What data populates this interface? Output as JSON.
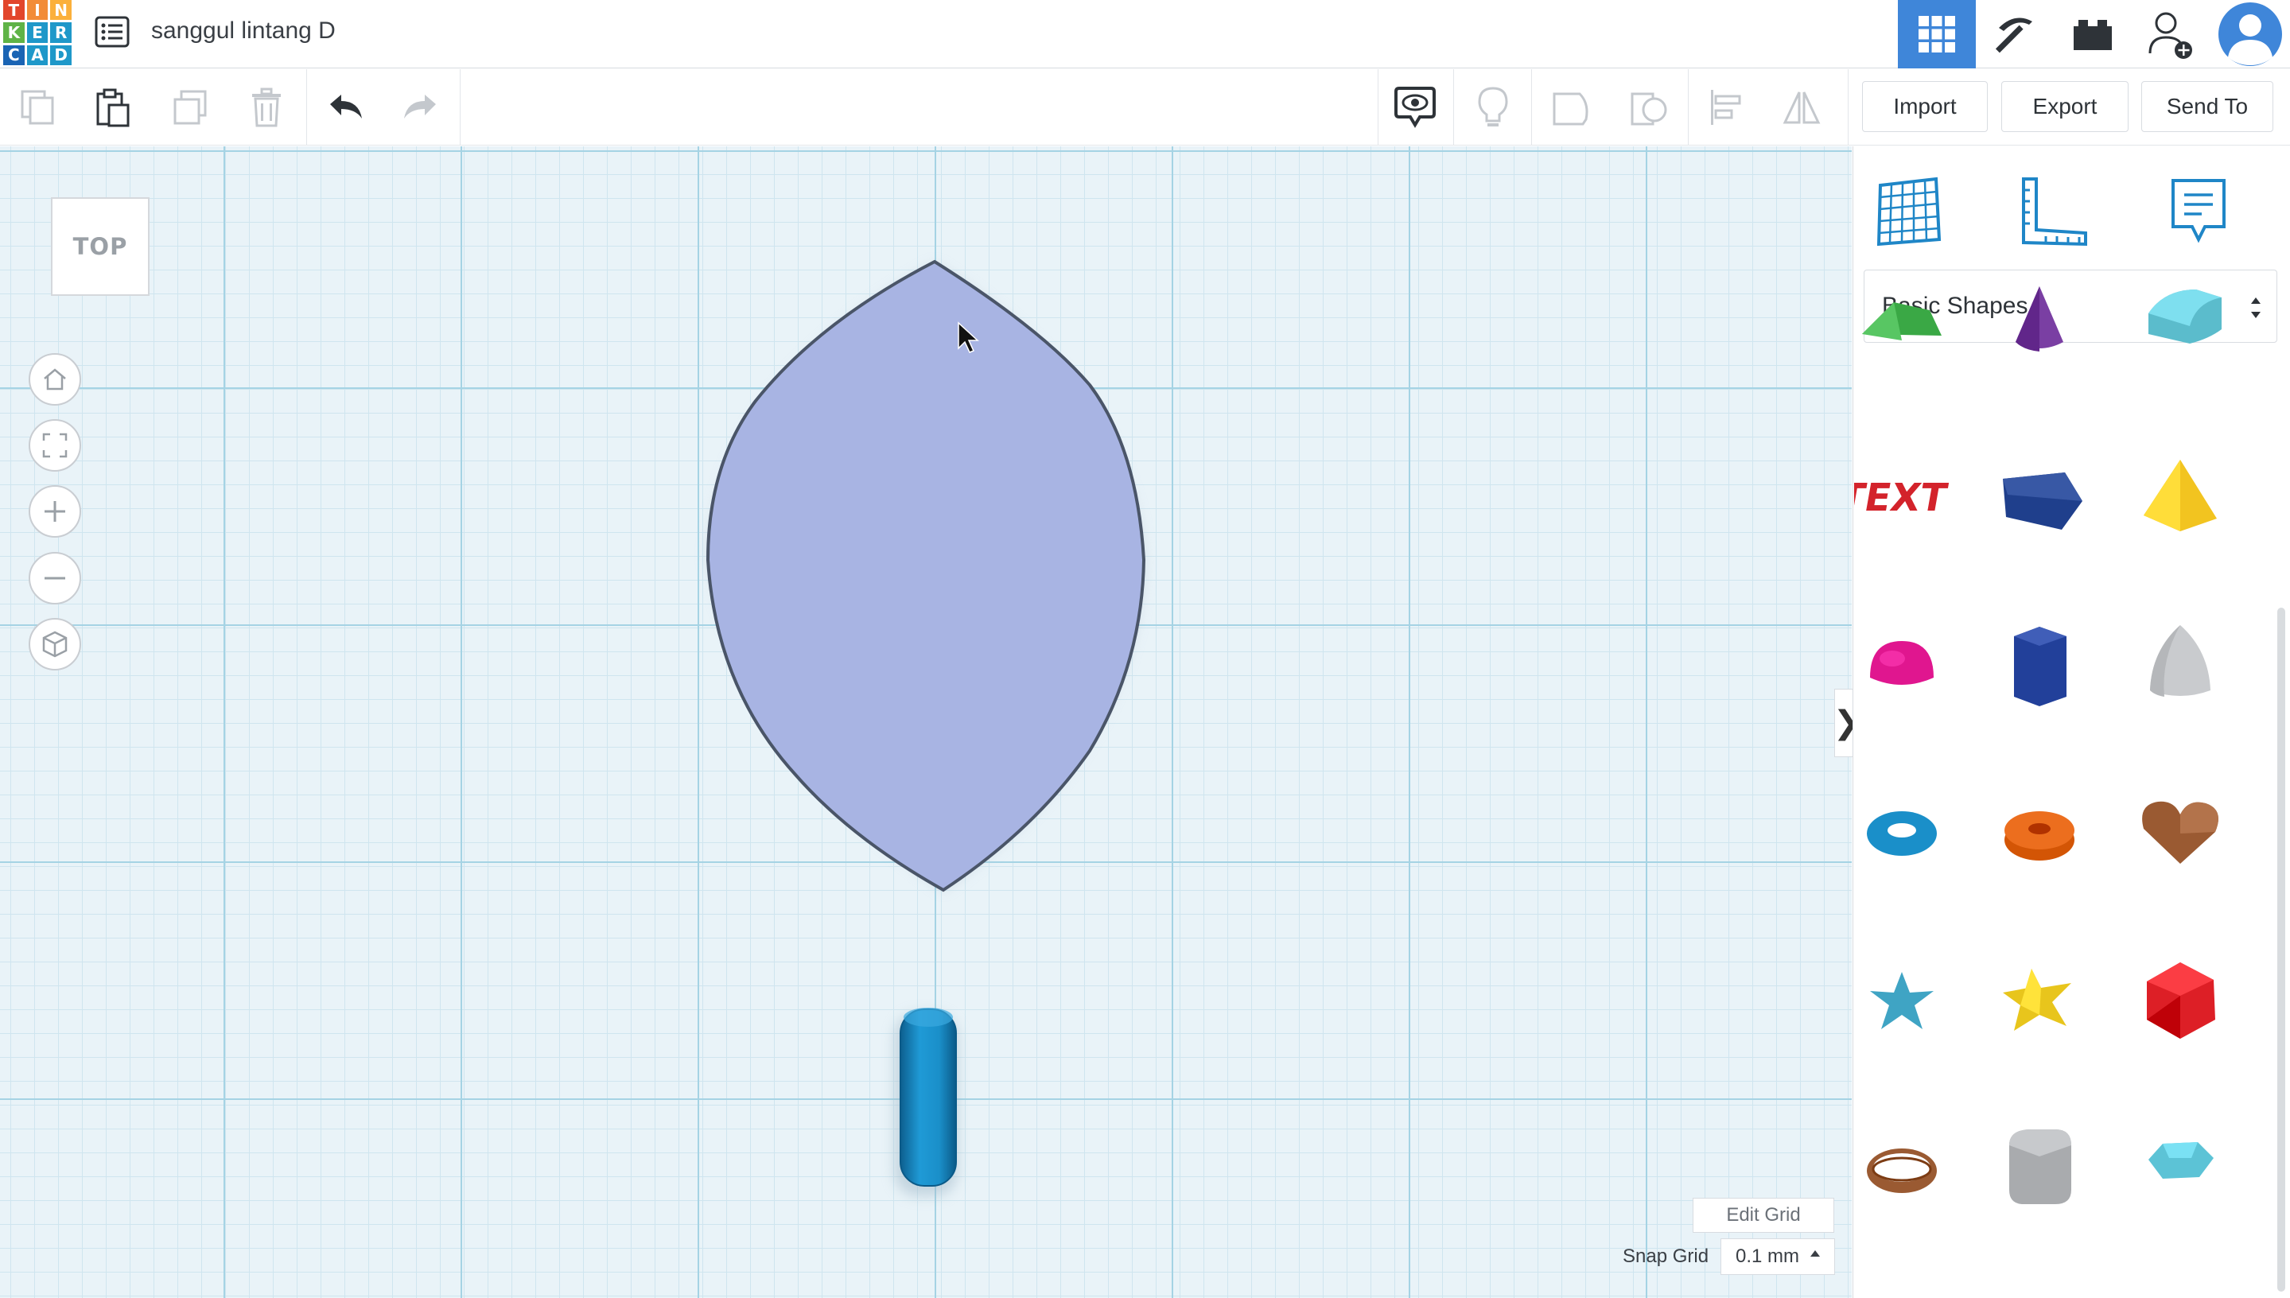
{
  "header": {
    "logo_letters": [
      "T",
      "I",
      "N",
      "K",
      "E",
      "R",
      "C",
      "A",
      "D"
    ],
    "logo_colors": [
      "#e2462c",
      "#f28c38",
      "#fbb03b",
      "#5fb346",
      "#1f98c9",
      "#1f98c9",
      "#1a64b4",
      "#1f98c9",
      "#1f98c9"
    ],
    "document_title": "sanggul lintang D"
  },
  "toolbar": {
    "import_label": "Import",
    "export_label": "Export",
    "send_to_label": "Send To"
  },
  "viewport": {
    "view_cube_label": "TOP"
  },
  "grid": {
    "edit_grid_label": "Edit Grid",
    "snap_grid_label": "Snap Grid",
    "snap_grid_value": "0.1 mm"
  },
  "panel": {
    "library_name": "Basic Shapes",
    "collapse_glyph": "❯",
    "shapes": [
      {
        "name": "Roof",
        "color": "#3aa845"
      },
      {
        "name": "Cone",
        "color": "#7a3fa3"
      },
      {
        "name": "Round Roof",
        "color": "#5bbccc"
      },
      {
        "name": "Text",
        "color": "#d3232b"
      },
      {
        "name": "Polygon",
        "color": "#1f3f8c"
      },
      {
        "name": "Pyramid",
        "color": "#f2c420"
      },
      {
        "name": "Half Sphere",
        "color": "#e0168f"
      },
      {
        "name": "Hexagonal Prism",
        "color": "#22409a"
      },
      {
        "name": "Paraboloid",
        "color": "#c9cbce"
      },
      {
        "name": "Torus",
        "color": "#1a8fc9"
      },
      {
        "name": "Tube",
        "color": "#ec6e1e"
      },
      {
        "name": "Heart",
        "color": "#9a5a32"
      },
      {
        "name": "Star",
        "color": "#3fa4c4"
      },
      {
        "name": "Star Six Point",
        "color": "#e8c51c"
      },
      {
        "name": "Icosahedron",
        "color": "#dd1f26"
      },
      {
        "name": "Ring",
        "color": "#9a5a32"
      },
      {
        "name": "Rounded Box",
        "color": "#a9abae"
      },
      {
        "name": "Diamond",
        "color": "#5cc3d6"
      }
    ]
  },
  "scene": {
    "leaf_color": "#a8b4e3",
    "leaf_outline": "#4a5568",
    "cylinder_color": "#1a8fc9"
  }
}
